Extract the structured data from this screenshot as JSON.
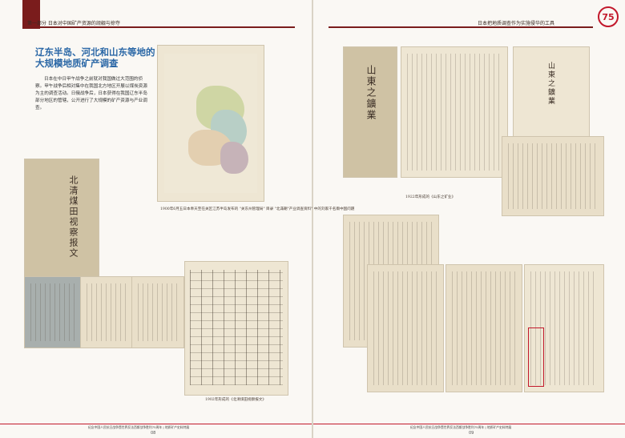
{
  "header": {
    "left_text": "第一部分  日本对中国矿产资源的觊觎与掠夺",
    "right_text": "日本把地质调查作为实施侵华的工具",
    "logo_text": "75"
  },
  "article": {
    "title": "辽东半岛、河北和山东等地的大规模地质矿产调查",
    "body": "日本在中日甲午战争之前就对我国做过大范围的侦察。甲午战争后相对集中在我国北方地区开展以煤炭资源为主的调查活动。日俄战争后，日本获得在我国辽东半岛部分地区的管辖，公开进行了大规模的矿产资源与产业调查。"
  },
  "images": {
    "book_cover_title": "北清煤田视察报文",
    "book_cover_small": "北清煤田视察报文",
    "map_caption": "1900年6月五日本奉天至在关区江苏半岛发布的 \"关东州管理局\" 目录 \"北滿朝\"产业调查资料\" 中的刘家千名兩中国问題",
    "table_caption": "1902年形成的《北清煤田视察报文》",
    "shandong_title": "山東之鑛業",
    "shandong_caption": "1922年形成的《山东之矿业》",
    "pamphlet_title": "山東之鑛業"
  },
  "footer": {
    "left_text": "纪念中国人民抗日战争暨世界反法西斯战争胜利75周年 | 地质矿产史料特展",
    "right_text": "纪念中国人民抗日战争暨世界反法西斯战争胜利75周年 | 地质矿产史料特展",
    "left_page": "08",
    "right_page": "09"
  }
}
